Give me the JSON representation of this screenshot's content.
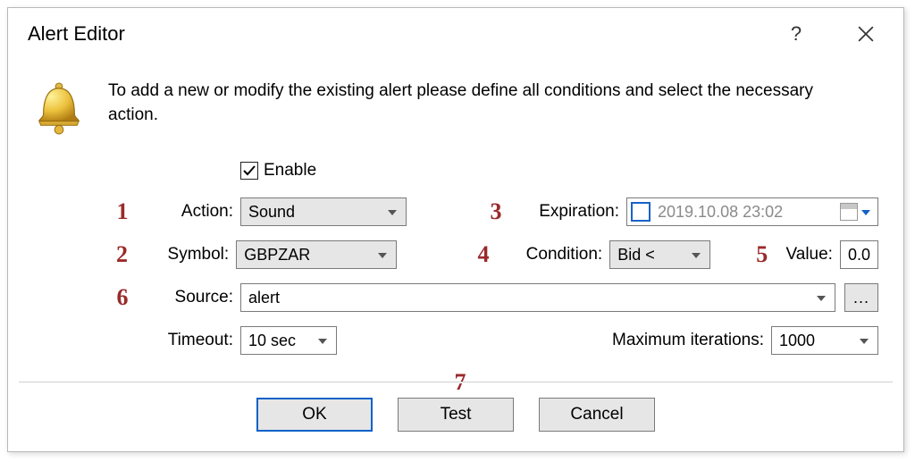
{
  "title": "Alert Editor",
  "intro": "To add a new or modify the existing alert please define all conditions and select the necessary action.",
  "enable": {
    "label": "Enable",
    "checked": true
  },
  "labels": {
    "action": "Action:",
    "symbol": "Symbol:",
    "expiration": "Expiration:",
    "condition": "Condition:",
    "value": "Value:",
    "source": "Source:",
    "timeout": "Timeout:",
    "maxIterations": "Maximum iterations:"
  },
  "values": {
    "action": "Sound",
    "symbol": "GBPZAR",
    "expiration": "2019.10.08 23:02",
    "condition": "Bid <",
    "value": "0.0",
    "source": "alert",
    "timeout": "10 sec",
    "maxIterations": "1000"
  },
  "annotations": {
    "n1": "1",
    "n2": "2",
    "n3": "3",
    "n4": "4",
    "n5": "5",
    "n6": "6",
    "n7": "7"
  },
  "buttons": {
    "ok": "OK",
    "test": "Test",
    "cancel": "Cancel",
    "browse": "..."
  }
}
